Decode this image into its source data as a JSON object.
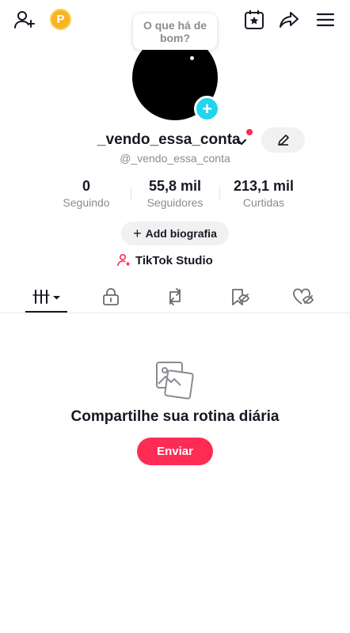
{
  "topbar": {
    "coin_label": "P",
    "icons": [
      "add-friend-icon",
      "coin-icon",
      "calendar-star-icon",
      "share-icon",
      "menu-icon"
    ]
  },
  "profile": {
    "bubble_text": "O que há de bom?",
    "username": "_vendo_essa_conta",
    "handle": "@_vendo_essa_conta",
    "stats": [
      {
        "value": "0",
        "label": "Seguindo"
      },
      {
        "value": "55,8 mil",
        "label": "Seguidores"
      },
      {
        "value": "213,1 mil",
        "label": "Curtidas"
      }
    ],
    "bio_button": "Add biografia",
    "studio_label": "TikTok Studio"
  },
  "tabs": [
    {
      "name": "videos",
      "icon": "grid-icon",
      "selected": true
    },
    {
      "name": "private",
      "icon": "lock-icon",
      "selected": false
    },
    {
      "name": "reposts",
      "icon": "repost-icon",
      "selected": false
    },
    {
      "name": "favorites",
      "icon": "bookmark-hidden-icon",
      "selected": false
    },
    {
      "name": "liked",
      "icon": "heart-hidden-icon",
      "selected": false
    }
  ],
  "empty_state": {
    "title": "Compartilhe sua rotina diária",
    "button": "Enviar"
  },
  "colors": {
    "accent": "#fe2c55",
    "avatar_add": "#20d5ec",
    "coin": "#f7b524",
    "text": "#161823",
    "muted": "#8a8b91"
  }
}
